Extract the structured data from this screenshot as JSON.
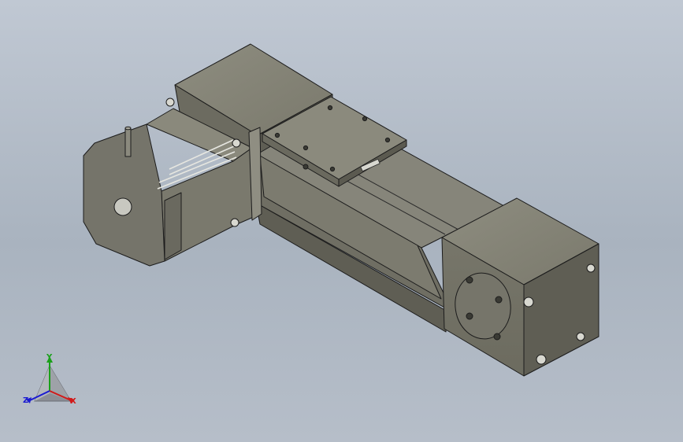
{
  "viewport": {
    "background_top": "#c0c8d3",
    "background_bottom": "#a9b3bf"
  },
  "model": {
    "description_icon": "linear-actuator-with-stepper-motor",
    "body_color": "#7d7c6e",
    "edge_color": "#1c1c1c"
  },
  "triad": {
    "x_label": "X",
    "y_label": "Y",
    "z_label": "Z",
    "x_color": "#d11a1a",
    "y_color": "#1aa01a",
    "z_color": "#1a1ad1"
  }
}
